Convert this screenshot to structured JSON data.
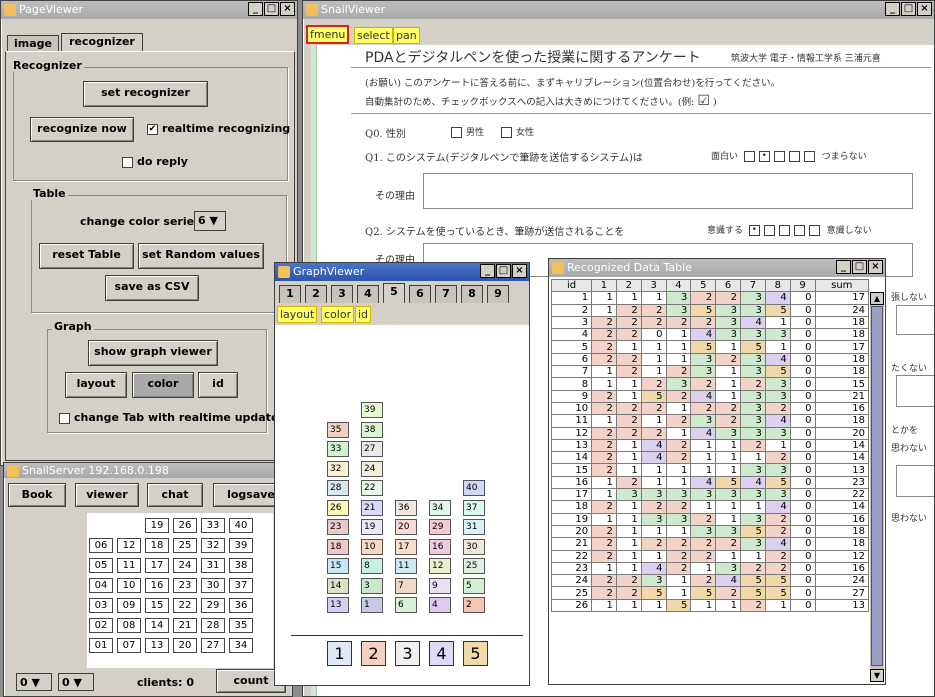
{
  "page_viewer": {
    "title": "PageViewer",
    "tabs": [
      "image",
      "recognizer"
    ],
    "recognizer_label": "Recognizer",
    "set_recognizer": "set recognizer",
    "recognize_now": "recognize now",
    "realtime_recognizing": "realtime recognizing",
    "do_reply": "do reply",
    "table_label": "Table",
    "change_color_series": "change color series",
    "color_series_value": "6",
    "reset_table": "reset Table",
    "set_random_values": "set Random values",
    "save_as_csv": "save as CSV",
    "graph_label": "Graph",
    "show_graph_viewer": "show graph viewer",
    "layout": "layout",
    "color": "color",
    "id": "id",
    "change_tab": "change Tab with realtime update"
  },
  "snail_server": {
    "title": "SnailServer 192.168.0.198",
    "buttons": [
      "Book",
      "viewer",
      "chat",
      "logsave"
    ],
    "grid": [
      [
        "",
        "",
        "19",
        "26",
        "33",
        "40"
      ],
      [
        "06",
        "12",
        "18",
        "25",
        "32",
        "39"
      ],
      [
        "05",
        "11",
        "17",
        "24",
        "31",
        "38"
      ],
      [
        "04",
        "10",
        "16",
        "23",
        "30",
        "37"
      ],
      [
        "03",
        "09",
        "15",
        "22",
        "29",
        "36"
      ],
      [
        "02",
        "08",
        "14",
        "21",
        "28",
        "35"
      ],
      [
        "01",
        "07",
        "13",
        "20",
        "27",
        "34"
      ]
    ],
    "combo1": "0",
    "combo2": "0",
    "clients_label": "clients:",
    "clients_value": "0",
    "count": "count"
  },
  "snail_viewer": {
    "title": "SnailViewer",
    "menu": [
      "fmenu",
      "select",
      "pan"
    ],
    "doc_title": "PDAとデジタルペンを使った授業に関するアンケート",
    "doc_author": "筑波大学 電子・情報工学系 三浦元喜",
    "request_line1": "(お願い)  このアンケートに答える前に、まずキャリブレーション(位置合わせ)を行ってください。",
    "request_line2": "自動集計のため、チェックボックスへの記入は大きめにつけてください。(例:",
    "example_check": "☑",
    "q0": "Q0. 性別",
    "q0_male": "男性",
    "q0_female": "女性",
    "q1": "Q1. このシステム(デジタルペンで筆跡を送信するシステム)は",
    "q1_left": "面白い",
    "q1_right": "つまらない",
    "reason": "その理由",
    "q2": "Q2. システムを使っているとき、筆跡が送信されることを",
    "q2_left": "意識する",
    "q2_right": "意識しない",
    "reason2": "その理由",
    "right_texts": [
      "張しない",
      "たくない",
      "とかを",
      "思わない",
      "思わない"
    ]
  },
  "graph_viewer": {
    "title": "GraphViewer",
    "tabs": [
      "1",
      "2",
      "3",
      "4",
      "5",
      "6",
      "7",
      "8",
      "9"
    ],
    "active_tab": "5",
    "buttons": [
      "layout",
      "color",
      "id"
    ],
    "columns": [
      {
        "label": "1",
        "ids": [
          "13",
          "14",
          "15",
          "18",
          "23",
          "26",
          "28",
          "32",
          "33",
          "35"
        ]
      },
      {
        "label": "2",
        "ids": [
          "1",
          "3",
          "8",
          "10",
          "19",
          "21",
          "22",
          "24",
          "27",
          "38",
          "39"
        ]
      },
      {
        "label": "3",
        "ids": [
          "6",
          "7",
          "11",
          "17",
          "20",
          "36"
        ]
      },
      {
        "label": "4",
        "ids": [
          "4",
          "9",
          "12",
          "16",
          "29",
          "34"
        ]
      },
      {
        "label": "5",
        "ids": [
          "2",
          "5",
          "25",
          "30",
          "31",
          "37",
          "40"
        ]
      }
    ],
    "colors": {
      "1": "#c8c8e8",
      "2": "#f6c6b4",
      "3": "#c8e6c8",
      "4": "#e0c8f0",
      "5": "#d4f0d4",
      "6": "#d8f0d8",
      "7": "#f0d8c8",
      "8": "#c8f0e0",
      "9": "#e8e0f8",
      "10": "#f8d8c0",
      "11": "#d0e8f0",
      "12": "#e8f0d0",
      "13": "#d0d0f0",
      "14": "#e0e0c8",
      "15": "#c8e8f8",
      "16": "#f0c8e0",
      "17": "#f8e0c8",
      "18": "#f0c8c8",
      "19": "#e8e8f8",
      "20": "#f8d8d8",
      "21": "#d8d8f8",
      "22": "#e8f8e8",
      "23": "#e8c8c8",
      "24": "#f0f0d8",
      "25": "#e0f0e0",
      "26": "#f8f8b8",
      "27": "#e8e8e8",
      "28": "#d8e8f0",
      "29": "#f8c8d0",
      "30": "#f0e8d8",
      "31": "#d8f0f8",
      "32": "#f8f0d0",
      "33": "#d0f0d0",
      "34": "#e0f8e8",
      "35": "#f0d0c0",
      "36": "#f0e8e0",
      "37": "#d8f8f0",
      "38": "#d8f8d0",
      "39": "#e8f8d0",
      "40": "#d0d8f8"
    }
  },
  "recognized_table": {
    "title": "Recognized Data Table",
    "headers": [
      "id",
      "1",
      "2",
      "3",
      "4",
      "5",
      "6",
      "7",
      "8",
      "9",
      "sum"
    ],
    "rows": [
      [
        1,
        1,
        1,
        1,
        3,
        2,
        2,
        3,
        4,
        0,
        17
      ],
      [
        2,
        1,
        2,
        2,
        3,
        5,
        3,
        3,
        5,
        0,
        24
      ],
      [
        3,
        2,
        2,
        2,
        2,
        2,
        3,
        4,
        1,
        0,
        18
      ],
      [
        4,
        2,
        2,
        0,
        1,
        4,
        3,
        3,
        3,
        0,
        18
      ],
      [
        5,
        2,
        1,
        1,
        1,
        5,
        1,
        5,
        1,
        0,
        17
      ],
      [
        6,
        2,
        2,
        1,
        1,
        3,
        2,
        3,
        4,
        0,
        18
      ],
      [
        7,
        1,
        2,
        1,
        2,
        3,
        1,
        3,
        5,
        0,
        18
      ],
      [
        8,
        1,
        1,
        2,
        3,
        2,
        1,
        2,
        3,
        0,
        15
      ],
      [
        9,
        2,
        1,
        5,
        2,
        4,
        1,
        3,
        3,
        0,
        21
      ],
      [
        10,
        2,
        2,
        2,
        1,
        2,
        2,
        3,
        2,
        0,
        16
      ],
      [
        11,
        1,
        2,
        1,
        2,
        3,
        2,
        3,
        4,
        0,
        18
      ],
      [
        12,
        2,
        2,
        2,
        1,
        4,
        3,
        3,
        3,
        0,
        20
      ],
      [
        13,
        2,
        1,
        4,
        2,
        1,
        1,
        2,
        1,
        0,
        14
      ],
      [
        14,
        2,
        1,
        4,
        2,
        1,
        1,
        1,
        2,
        0,
        14
      ],
      [
        15,
        2,
        1,
        1,
        1,
        1,
        1,
        3,
        3,
        0,
        13
      ],
      [
        16,
        1,
        2,
        1,
        1,
        4,
        5,
        4,
        5,
        0,
        23
      ],
      [
        17,
        1,
        3,
        3,
        3,
        3,
        3,
        3,
        3,
        0,
        22
      ],
      [
        18,
        2,
        1,
        2,
        2,
        1,
        1,
        1,
        4,
        0,
        14
      ],
      [
        19,
        1,
        1,
        3,
        3,
        2,
        1,
        3,
        2,
        0,
        16
      ],
      [
        20,
        2,
        1,
        1,
        1,
        3,
        3,
        5,
        2,
        0,
        18
      ],
      [
        21,
        2,
        1,
        2,
        2,
        2,
        2,
        3,
        4,
        0,
        18
      ],
      [
        22,
        2,
        1,
        1,
        2,
        2,
        1,
        1,
        2,
        0,
        12
      ],
      [
        23,
        1,
        1,
        4,
        2,
        1,
        3,
        2,
        2,
        0,
        16
      ],
      [
        24,
        2,
        2,
        3,
        1,
        2,
        4,
        5,
        5,
        0,
        24
      ],
      [
        25,
        2,
        2,
        5,
        1,
        5,
        2,
        5,
        5,
        0,
        27
      ],
      [
        26,
        1,
        1,
        1,
        5,
        1,
        1,
        2,
        1,
        0,
        13
      ]
    ],
    "value_colors": {
      "0": "#ffffff",
      "1": "#ffffff",
      "2": "#f3d3c8",
      "3": "#cfe9cf",
      "4": "#dcd0f0",
      "5": "#f0d8a8"
    }
  }
}
